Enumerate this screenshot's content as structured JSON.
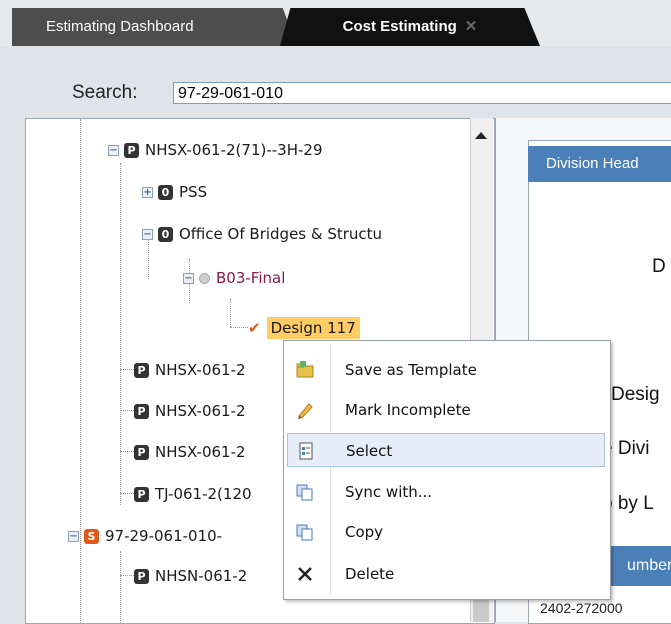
{
  "tabs": [
    {
      "label": "Estimating Dashboard",
      "active": false
    },
    {
      "label": "Cost Estimating",
      "active": true,
      "close": "✕"
    }
  ],
  "search": {
    "label": "Search:",
    "value": "97-29-061-010"
  },
  "tree": [
    {
      "label": "NHSX-061-2(71)--3H-29",
      "badge": "P",
      "expander": "−"
    },
    {
      "label": "PSS",
      "badge": "0",
      "expander": "+"
    },
    {
      "label": "Office Of Bridges & Structu",
      "badge": "0",
      "expander": "−"
    },
    {
      "label": "B03-Final",
      "expander": "−"
    },
    {
      "label": "Design 117"
    },
    {
      "label": "NHSX-061-2",
      "badge": "P"
    },
    {
      "label": "NHSX-061-2",
      "badge": "P"
    },
    {
      "label": "NHSX-061-2",
      "badge": "P"
    },
    {
      "label": "TJ-061-2(120",
      "badge": "P"
    },
    {
      "label": "97-29-061-010-",
      "badge": "S",
      "expander": "−"
    },
    {
      "label": "NHSN-061-2",
      "badge": "P"
    }
  ],
  "context_menu": [
    {
      "label": "Save as Template",
      "icon": "folder-template-icon"
    },
    {
      "label": "Mark Incomplete",
      "icon": "pencil-icon"
    },
    {
      "label": "Select",
      "icon": "document-select-icon",
      "highlighted": true
    },
    {
      "label": "Sync with...",
      "icon": "sync-copy-icon"
    },
    {
      "label": "Copy",
      "icon": "copy-icon"
    },
    {
      "label": "Delete",
      "icon": "delete-x-icon"
    }
  ],
  "right_panel": {
    "division_header": "Division Head",
    "text_d": "D",
    "text_desig": "Desig",
    "text_divi": "e Divi",
    "text_byl": "p by L",
    "number_header": "umber",
    "number_cell": "2402-272000"
  },
  "colors": {
    "accent": "#4a7fb8",
    "selection": "#ffcc66",
    "s_badge": "#e05a1b"
  }
}
